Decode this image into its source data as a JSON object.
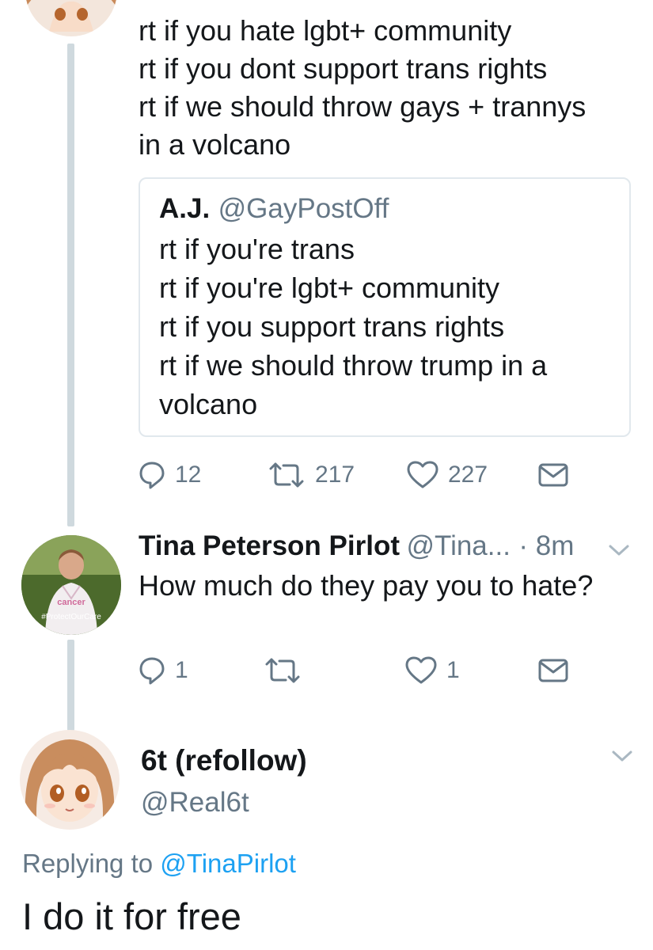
{
  "tweet1": {
    "lines": [
      "rt if you hate lgbt+ community",
      "rt if you dont support trans rights",
      "rt if we should throw gays + trannys",
      "in a volcano"
    ],
    "quote": {
      "name": "A.J.",
      "handle": "@GayPostOff",
      "lines": [
        "rt if you're trans",
        "rt if you're lgbt+ community",
        "rt if you support trans rights",
        "rt if we should throw trump in a",
        "volcano"
      ]
    },
    "actions": {
      "replies": "12",
      "retweets": "217",
      "likes": "227"
    }
  },
  "tweet2": {
    "name": "Tina Peterson Pirlot",
    "handle": "@Tina...",
    "time": "· 8m",
    "text": "How much do they pay you to hate?",
    "avatar_caption": "#ProtectOurCare",
    "avatar_shirt_text": "cancer",
    "actions": {
      "replies": "1",
      "retweets": "",
      "likes": "1"
    }
  },
  "tweet3": {
    "name": "6t (refollow)",
    "handle": "@Real6t",
    "replying_label": "Replying to",
    "replying_handle": "@TinaPirlot",
    "text": "I do it for free"
  },
  "colors": {
    "text": "#14171a",
    "secondary": "#657786",
    "link": "#1da1f2",
    "thread_line": "#cfd9de",
    "border": "#e1e8ed"
  },
  "icons": {
    "reply": "reply-icon",
    "retweet": "retweet-icon",
    "like": "heart-icon",
    "message": "envelope-icon",
    "menu": "chevron-down-icon"
  }
}
